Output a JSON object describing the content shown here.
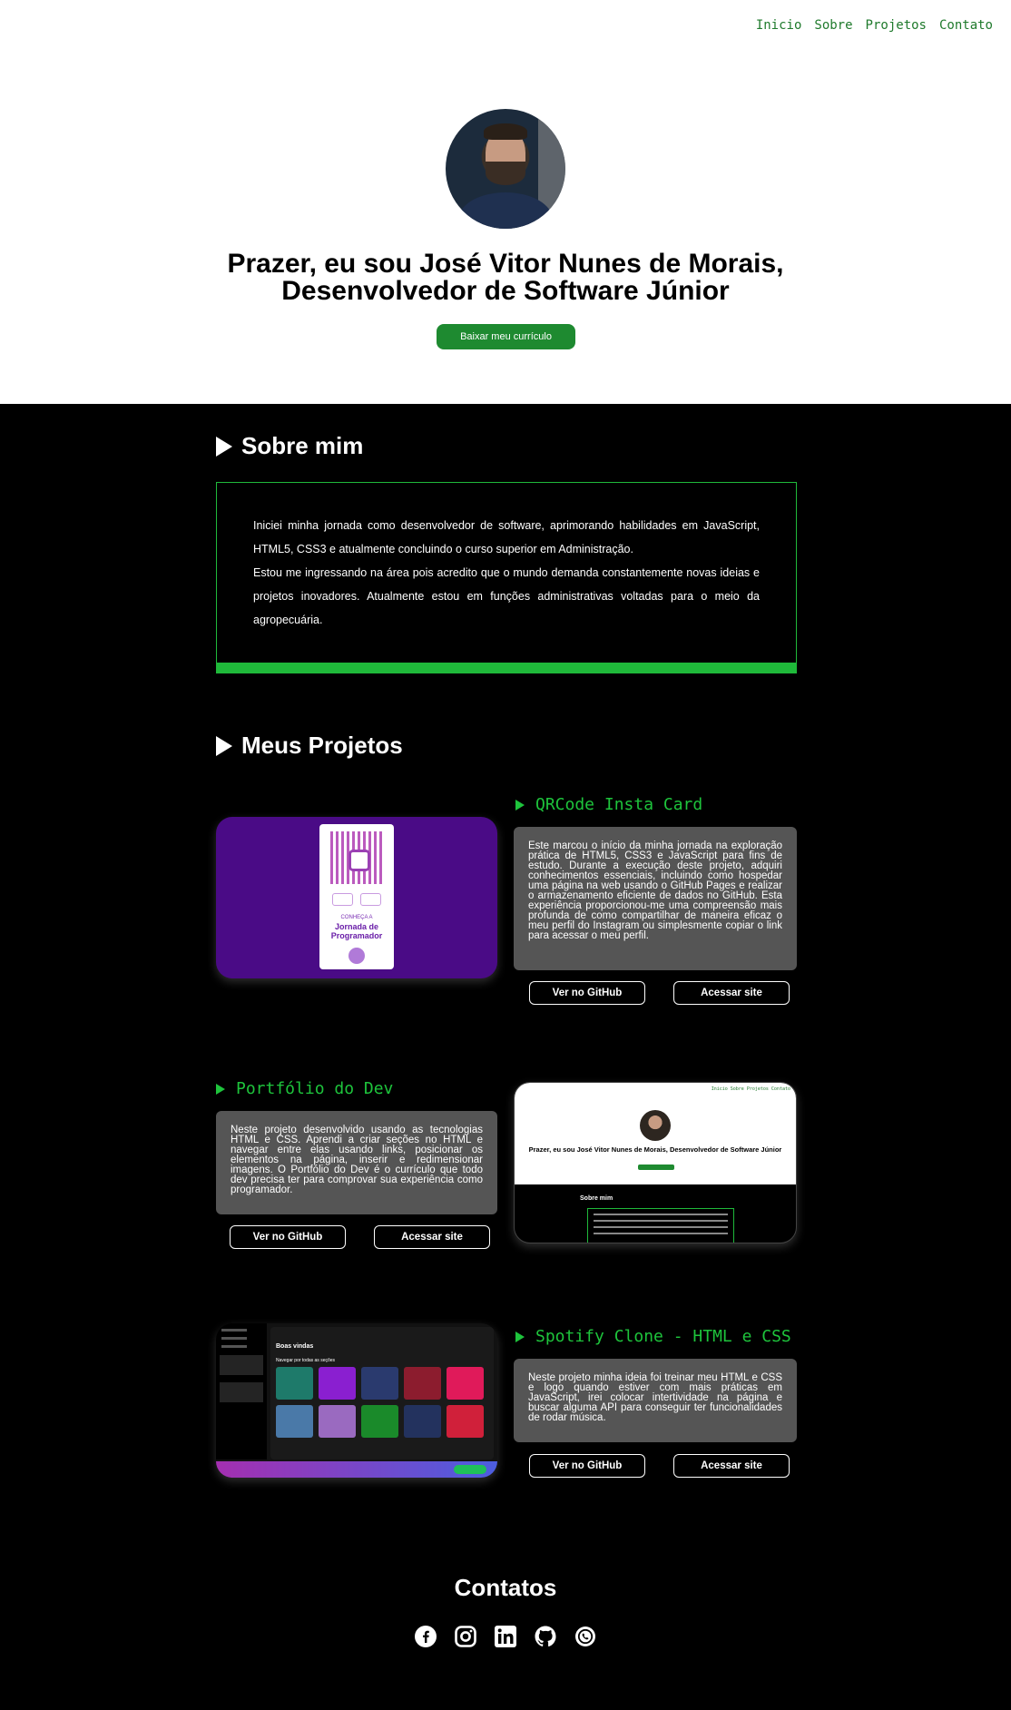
{
  "nav": {
    "items": [
      "Inicio",
      "Sobre",
      "Projetos",
      "Contato"
    ]
  },
  "hero": {
    "title_line1": "Prazer, eu sou José Vitor Nunes de Morais,",
    "title_line2": "Desenvolvedor de Software Júnior",
    "cv_button": "Baixar meu currículo"
  },
  "about": {
    "heading": "Sobre mim",
    "paragraph1": "Iniciei minha jornada como desenvolvedor de software, aprimorando habilidades em JavaScript, HTML5, CSS3 e atualmente concluindo o curso superior em Administração.",
    "paragraph2": "Estou me ingressando na área pois acredito que o mundo demanda constantemente novas ideias e projetos inovadores. Atualmente estou em funções administrativas voltadas para o meio da agropecuária."
  },
  "projects": {
    "heading": "Meus Projetos",
    "items": [
      {
        "title": "QRCode Insta Card",
        "description": "Este marcou o início da minha jornada na exploração prática de HTML5, CSS3 e JavaScript para fins de estudo. Durante a execução deste projeto, adquiri conhecimentos essenciais, incluindo como hospedar uma página na web usando o GitHub Pages e realizar o armazenamento eficiente de dados no GitHub. Esta experiência proporcionou-me uma compreensão mais profunda de como compartilhar de maneira eficaz o meu perfil do Instagram ou simplesmente copiar o link para acessar o meu perfil.",
        "github_label": "Ver no GitHub",
        "site_label": "Acessar site",
        "thumb_text1": "CONHEÇA A",
        "thumb_text2": "Jornada de Programador"
      },
      {
        "title": "Portfólio do Dev",
        "description": "Neste projeto desenvolvido usando as tecnologias HTML e CSS. Aprendi a criar seções no HTML e navegar entre elas usando links, posicionar os elementos na página, inserir e redimensionar imagens. O Portfólio do Dev é o currículo que todo dev precisa ter para comprovar sua experiência como programador.",
        "github_label": "Ver no GitHub",
        "site_label": "Acessar site",
        "thumb_nav": "Inicio Sobre Projetos Contato",
        "thumb_title": "Prazer, eu sou José Vitor Nunes de Morais, Desenvolvedor de Software Júnior",
        "thumb_sobre": "Sobre mim"
      },
      {
        "title": "Spotify Clone - HTML e CSS",
        "description": "Neste projeto minha ideia foi treinar meu HTML e CSS e logo quando estiver com mais práticas em JavaScript, irei colocar intertividade na página e buscar alguma API para conseguir ter funcionalidades de rodar música.",
        "github_label": "Ver no GitHub",
        "site_label": "Acessar site",
        "thumb_head": "Boas vindas",
        "thumb_sub": "Navegar por todas as seções"
      }
    ]
  },
  "contacts": {
    "heading": "Contatos",
    "icons": [
      "facebook-icon",
      "instagram-icon",
      "linkedin-icon",
      "github-icon",
      "whatsapp-icon"
    ]
  },
  "colors": {
    "accent_green": "#1ec43c",
    "button_green": "#1e8a30",
    "card_gray": "#555555"
  }
}
